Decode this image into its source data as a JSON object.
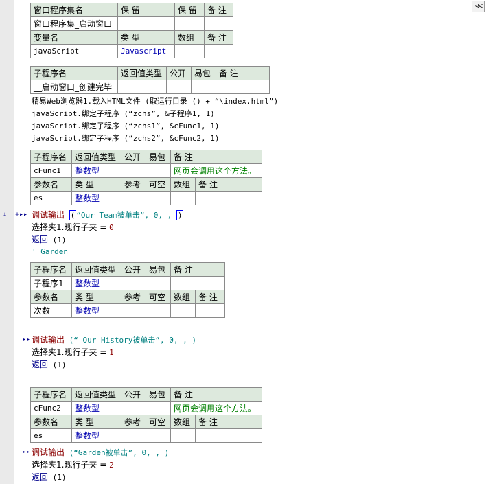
{
  "toolbar": {
    "collapse_label": "<<"
  },
  "module_table": {
    "headers": [
      "窗口程序集名",
      "保 留",
      "保 留",
      "备 注"
    ],
    "row": [
      "窗口程序集_启动窗口",
      "",
      "",
      ""
    ],
    "var_headers": [
      "变量名",
      "类 型",
      "数组",
      "备 注"
    ],
    "var_row": [
      "javaScript",
      "Javascript",
      "",
      ""
    ]
  },
  "sub1_table": {
    "headers": [
      "子程序名",
      "返回值类型",
      "公开",
      "易包",
      "备 注"
    ],
    "row": [
      "__启动窗口_创建完毕",
      "",
      "",
      "",
      ""
    ]
  },
  "sub1_code": [
    "精易Web浏览器1.载入HTML文件 (取运行目录 () + “\\index.html”)",
    "javaScript.绑定子程序 (“zchs”, &子程序1, 1)",
    "javaScript.绑定子程序 (“zchs1”, &cFunc1, 1)",
    "javaScript.绑定子程序 (“zchs2”, &cFunc2, 1)"
  ],
  "cfunc1_table": {
    "headers": [
      "子程序名",
      "返回值类型",
      "公开",
      "易包",
      "备 注"
    ],
    "row": [
      "cFunc1",
      "整数型",
      "",
      "",
      "网页会调用这个方法。"
    ],
    "param_headers": [
      "参数名",
      "类 型",
      "参考",
      "可空",
      "数组",
      "备 注"
    ],
    "param_row": [
      "es",
      "整数型",
      "",
      "",
      "",
      ""
    ]
  },
  "cfunc1_code": {
    "line1_cmd": "调试输出",
    "line1_args": "“Our Team被单击”, 0, , ",
    "line2": "选择夹1.现行子夹 = ",
    "line2_num": "0",
    "line3_cmd": "返回",
    "line3_args": " (1)",
    "line4": "' Garden"
  },
  "sub_child_table": {
    "headers": [
      "子程序名",
      "返回值类型",
      "公开",
      "易包",
      "备 注"
    ],
    "row": [
      "子程序1",
      "整数型",
      "",
      "",
      ""
    ],
    "param_headers": [
      "参数名",
      "类 型",
      "参考",
      "可空",
      "数组",
      "备 注"
    ],
    "param_row": [
      "次数",
      "整数型",
      "",
      "",
      "",
      ""
    ]
  },
  "sub_child_code": {
    "line1_cmd": "调试输出",
    "line1_args": " (“ Our History被单击”, 0, , )",
    "line2": "选择夹1.现行子夹 = ",
    "line2_num": "1",
    "line3_cmd": "返回",
    "line3_args": " (1)"
  },
  "cfunc2_table": {
    "headers": [
      "子程序名",
      "返回值类型",
      "公开",
      "易包",
      "备 注"
    ],
    "row": [
      "cFunc2",
      "整数型",
      "",
      "",
      "网页会调用这个方法。"
    ],
    "param_headers": [
      "参数名",
      "类 型",
      "参考",
      "可空",
      "数组",
      "备 注"
    ],
    "param_row": [
      "es",
      "整数型",
      "",
      "",
      "",
      ""
    ]
  },
  "cfunc2_code": {
    "line1_cmd": "调试输出",
    "line1_args": " (“Garden被单击”, 0, , )",
    "line2": "选择夹1.现行子夹 = ",
    "line2_num": "2",
    "line3_cmd": "返回",
    "line3_args": " (1)"
  },
  "markers": {
    "arrow": "↓",
    "plus": "+▸▸",
    "flow": "▸▸"
  }
}
